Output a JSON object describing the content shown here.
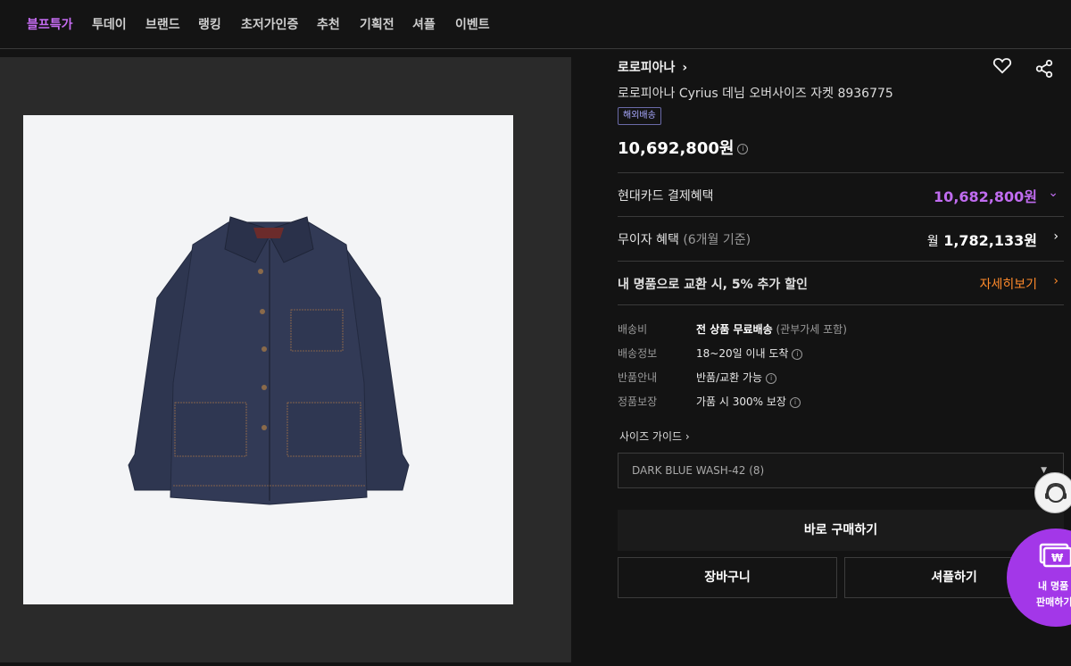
{
  "nav": {
    "items": [
      {
        "label": "블프특가",
        "active": true
      },
      {
        "label": "투데이",
        "active": false
      },
      {
        "label": "브랜드",
        "active": false
      },
      {
        "label": "랭킹",
        "active": false
      },
      {
        "label": "초저가인증",
        "active": false
      },
      {
        "label": "추천",
        "active": false
      },
      {
        "label": "기획전",
        "active": false
      },
      {
        "label": "셔플",
        "active": false
      },
      {
        "label": "이벤트",
        "active": false
      }
    ]
  },
  "product": {
    "brand": "로로피아나",
    "title": "로로피아나 Cyrius 데님 오버사이즈 자켓 8936775",
    "badge": "해외배송",
    "price": "10,692,800원",
    "image_icon": "denim-jacket-image"
  },
  "benefits": {
    "card_label": "현대카드 결제혜택",
    "card_price": "10,682,800원",
    "installment_label": "무이자 혜택",
    "installment_sub": "(6개월 기준)",
    "installment_prefix": "월",
    "installment_value": "1,782,133원",
    "trade_in_label": "내 명품으로 교환 시, 5% 추가 할인",
    "trade_in_link": "자세히보기"
  },
  "shipping": {
    "fee_key": "배송비",
    "fee_value": "전 상품 무료배송",
    "fee_note": "(관부가세 포함)",
    "info_key": "배송정보",
    "info_value": "18~20일 이내 도착",
    "return_key": "반품안내",
    "return_value": "반품/교환 가능",
    "auth_key": "정품보장",
    "auth_value": "가품 시 300% 보장"
  },
  "size_guide": "사이즈 가이드",
  "option": {
    "selected": "DARK BLUE WASH-42 (8)"
  },
  "actions": {
    "buy": "바로 구매하기",
    "cart": "장바구니",
    "shuffle": "셔플하기"
  },
  "floating": {
    "sell_line1": "내 명품",
    "sell_line2": "판매하기"
  },
  "colors": {
    "accent": "#c56cf0",
    "orange": "#ff8a2b",
    "sell_button": "#a337e8"
  }
}
